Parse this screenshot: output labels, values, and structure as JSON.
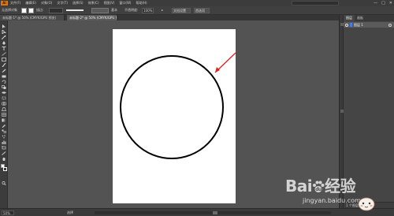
{
  "app": {
    "logo": "Ai",
    "menus": [
      "文件(F)",
      "编辑(E)",
      "对象(O)",
      "文字(T)",
      "选择(S)",
      "效果(C)",
      "视图(V)",
      "窗口(W)",
      "帮助(H)"
    ],
    "window_controls": [
      "—",
      "□",
      "✕"
    ]
  },
  "control_bar": {
    "selection_label": "无选择对象",
    "stroke_label": "描边:",
    "style_label": "基本",
    "opacity_label": "不透明度:",
    "opacity_value": "100%",
    "doc_setup_label": "文档设置",
    "prefs_label": "首选项"
  },
  "tabs": [
    {
      "label": "未标题-1* @ 50% (CMYK/GPU 预览)",
      "active": false
    },
    {
      "label": "未标题-2* @ 50% (CMYK/GPU 预览)",
      "active": true
    }
  ],
  "layers_panel": {
    "tabs": [
      {
        "label": "图层",
        "active": true
      },
      {
        "label": "画板",
        "active": false
      }
    ],
    "layers": [
      {
        "name": "图层 1",
        "color": "#3f7df0"
      }
    ],
    "footer": "1 个图层"
  },
  "status": {
    "zoom": "50%",
    "state": "选择"
  },
  "watermark": {
    "logo_text_left": "Bai",
    "logo_text_right": "经验",
    "sub": "jingyan.baidu.com"
  },
  "colors": {
    "annotation_arrow": "#e02020",
    "artboard": "#ffffff",
    "workspace": "#535353"
  },
  "icons": [
    "selection-tool-icon",
    "direct-selection-icon",
    "magic-wand-icon",
    "pen-tool-icon",
    "type-tool-icon",
    "line-tool-icon",
    "rectangle-tool-icon",
    "paintbrush-icon",
    "pencil-icon",
    "eraser-icon",
    "rotate-icon",
    "scale-icon",
    "width-icon",
    "free-transform-icon",
    "shape-builder-icon",
    "perspective-icon",
    "mesh-icon",
    "gradient-icon",
    "eyedropper-icon",
    "blend-icon",
    "symbol-sprayer-icon",
    "column-graph-icon",
    "artboard-tool-icon",
    "slice-icon",
    "hand-icon",
    "zoom-icon"
  ]
}
